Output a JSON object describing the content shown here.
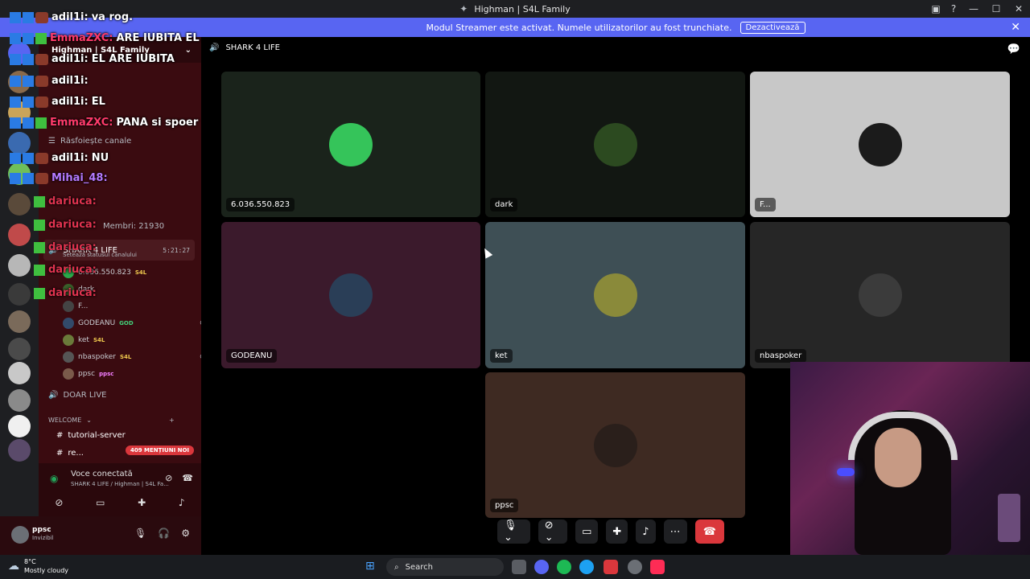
{
  "window": {
    "title": "Highman | S4L Family",
    "controls": [
      "—",
      "☐",
      "✕"
    ]
  },
  "banner": {
    "text": "Modul Streamer este activat. Numele utilizatorilor au fost trunchiate.",
    "button": "Dezactivează"
  },
  "server": {
    "name": "Highman | S4L Family"
  },
  "sidebar": {
    "browse": "Răsfoiește canale",
    "members_text": "Membri: 21930",
    "active_channel": "SHARK 4 LIFE",
    "active_status": "Setează statusul canalului",
    "active_time": "5:21:27",
    "members": [
      {
        "name": "6.036.550.823",
        "tag": "S4L",
        "color": "#2aa84a"
      },
      {
        "name": "dark",
        "tag": "",
        "color": "#3a5f2a"
      },
      {
        "name": "F...",
        "tag": "",
        "color": "#444"
      },
      {
        "name": "GODEANU",
        "tag": "GOD",
        "color": "#324a6a"
      },
      {
        "name": "ket",
        "tag": "S4L",
        "color": "#6a7a3a"
      },
      {
        "name": "nbaspoker",
        "tag": "S4L",
        "color": "#555"
      },
      {
        "name": "ppsc",
        "tag": "ppsc",
        "color": "#7a5a4a"
      }
    ],
    "doar_live": "DOAR LIVE",
    "category": "WELCOME",
    "channels": [
      "tutorial-server",
      "re..."
    ],
    "mentions": "409 MENȚIUNI NOI"
  },
  "voice": {
    "status": "Voce conectată",
    "sub": "SHARK 4 LIFE / Highman | S4L Fa..."
  },
  "user": {
    "name": "ppsc",
    "status": "Invizibil"
  },
  "chat": [
    {
      "user": "adil1i:",
      "msg": "va rog."
    },
    {
      "user": "EmmaZXC:",
      "msg": "ARE IUBITA EL"
    },
    {
      "user": "adil1i:",
      "msg": "EL ARE IUBITA"
    },
    {
      "user": "adil1i:",
      "msg": ""
    },
    {
      "user": "adil1i:",
      "msg": "EL"
    },
    {
      "user": "EmmaZXC:",
      "msg": "PANA si spoer"
    },
    {
      "user": "adil1i:",
      "msg": "NU"
    },
    {
      "user": "Mihai_48:",
      "msg": ""
    },
    {
      "user": "dariuca:",
      "msg": ""
    },
    {
      "user": "dariuca:",
      "msg": ""
    },
    {
      "user": "dariuca:",
      "msg": ""
    },
    {
      "user": "dariuca:",
      "msg": ""
    },
    {
      "user": "dariuca:",
      "msg": ""
    }
  ],
  "main": {
    "channel": "SHARK 4 LIFE",
    "tiles": [
      {
        "label": "6.036.550.823",
        "bg": "#1a231b",
        "av": "#35c45a"
      },
      {
        "label": "dark",
        "bg": "#121712",
        "av": "#2c4a20"
      },
      {
        "label": "F...",
        "bg": "#c8c8c8",
        "av": "#1b1b1b"
      },
      {
        "label": "GODEANU",
        "bg": "#3b1a2c",
        "av": "#2a3e57"
      },
      {
        "label": "ket",
        "bg": "#3e4f55",
        "av": "#8a8a3a"
      },
      {
        "label": "nbaspoker",
        "bg": "#262626",
        "av": "#3b3b3b"
      },
      {
        "label": "ppsc",
        "bg": "#3e2a22",
        "av": "#2a1f1b"
      }
    ]
  },
  "taskbar": {
    "temp": "8°C",
    "weather": "Mostly cloudy",
    "search": "Search"
  }
}
